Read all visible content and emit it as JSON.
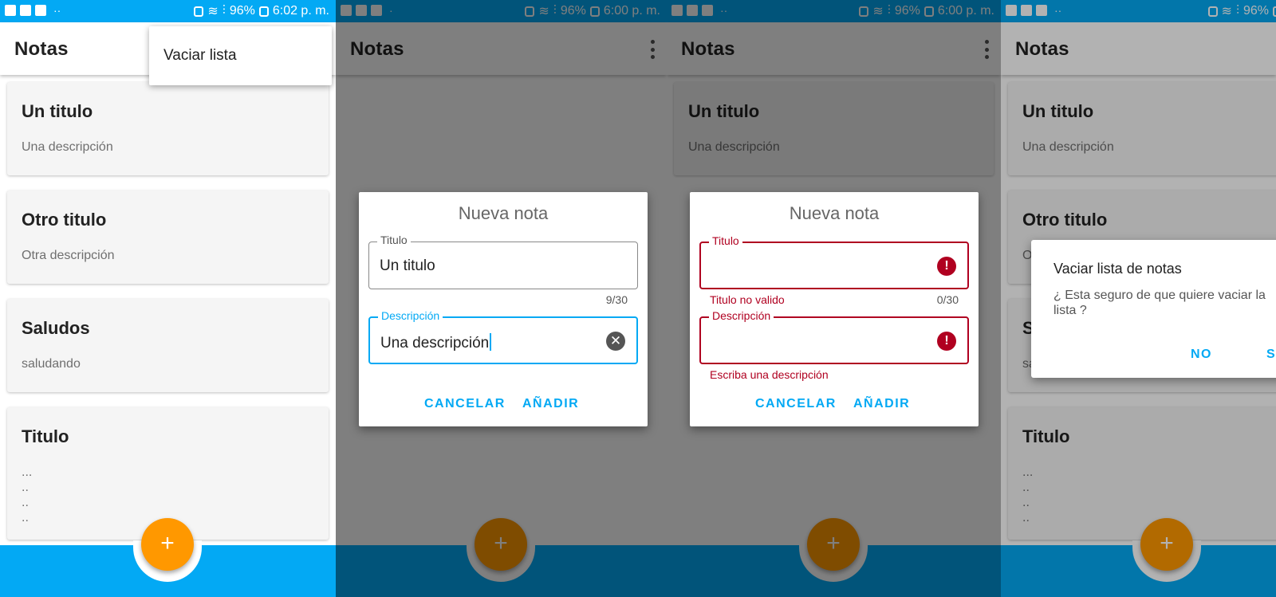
{
  "status_bars": [
    {
      "battery": "96%",
      "time": "6:02 p. m."
    },
    {
      "battery": "96%",
      "time": "6:00 p. m."
    },
    {
      "battery": "96%",
      "time": "6:00 p. m."
    },
    {
      "battery": "96%",
      "time": ""
    }
  ],
  "app": {
    "title": "Notas",
    "fab_label": "+"
  },
  "notes": [
    {
      "title": "Un titulo",
      "description": "Una descripción"
    },
    {
      "title": "Otro titulo",
      "description": "Otra descripción"
    },
    {
      "title": "Saludos",
      "description": "saludando"
    },
    {
      "title": "Titulo",
      "description": "...\n..\n..\n.."
    }
  ],
  "overflow_menu": {
    "items": [
      "Vaciar lista"
    ]
  },
  "new_note_dialog": {
    "title": "Nueva nota",
    "title_field_label": "Titulo",
    "description_field_label": "Descripción",
    "cancel_label": "CANCELAR",
    "add_label": "AÑADIR"
  },
  "dialog_filled": {
    "title_value": "Un titulo",
    "title_counter": "9/30",
    "description_value": "Una descripción"
  },
  "dialog_error": {
    "title_error": "Titulo no valido",
    "title_counter": "0/30",
    "description_error": "Escriba una descripción"
  },
  "confirm_dialog": {
    "title": "Vaciar lista de notas",
    "message": "¿ Esta seguro de que quiere vaciar la lista ?",
    "message_visible_line1": "¿ Esta seguro de que quiere vaciar la",
    "message_visible_line2": "lista ?",
    "no_label": "NO",
    "yes_label": "SI"
  },
  "colors": {
    "primary": "#03a9f4",
    "accent": "#ff9800",
    "error": "#b00020"
  },
  "icons": [
    "facebook-icon",
    "gallery-icon",
    "alarm-icon",
    "wifi-icon",
    "signal-icon",
    "battery-icon",
    "more-vert-icon",
    "add-icon",
    "clear-icon",
    "error-icon"
  ]
}
